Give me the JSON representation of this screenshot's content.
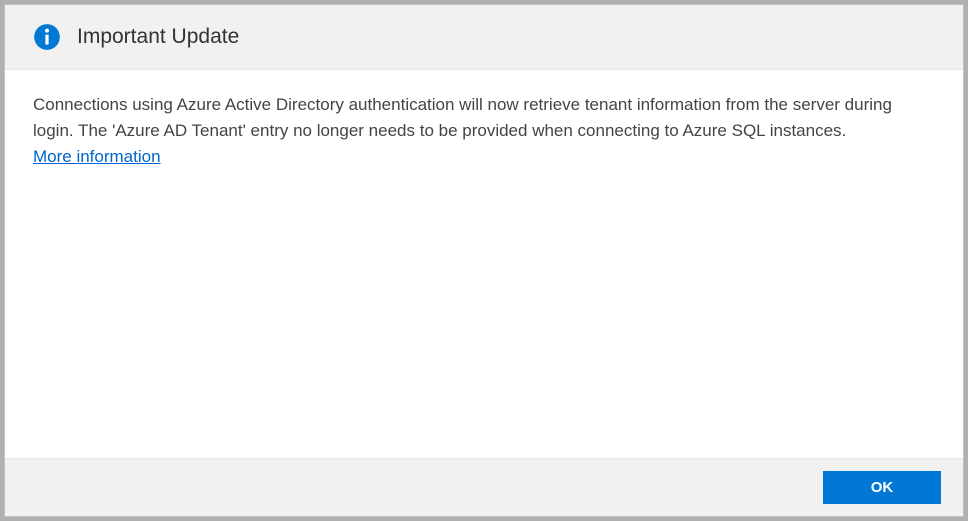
{
  "header": {
    "title": "Important Update"
  },
  "body": {
    "message": "Connections using Azure Active Directory authentication will now retrieve tenant information from the server during login. The 'Azure AD Tenant' entry no longer needs to be provided when connecting to Azure SQL instances.",
    "moreInfoLabel": "More information"
  },
  "footer": {
    "okLabel": "OK"
  },
  "colors": {
    "accent": "#0078d4",
    "link": "#0066cc",
    "headerBg": "#f1f1f1",
    "footerBg": "#f1f1f1"
  }
}
